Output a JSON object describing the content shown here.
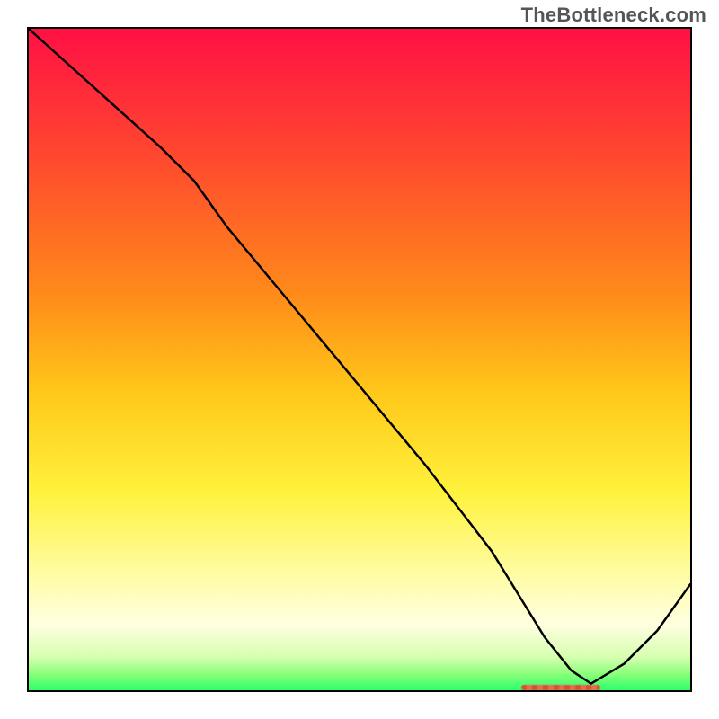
{
  "watermark": "TheBottleneck.com",
  "chart_data": {
    "type": "line",
    "title": "",
    "xlabel": "",
    "ylabel": "",
    "xlim": [
      0,
      100
    ],
    "ylim": [
      0,
      100
    ],
    "x": [
      0,
      10,
      20,
      25,
      30,
      40,
      50,
      60,
      70,
      78,
      82,
      85,
      90,
      95,
      100
    ],
    "y": [
      100,
      91,
      82,
      77,
      70,
      58,
      46,
      34,
      21,
      8,
      3,
      1,
      4,
      9,
      16
    ],
    "gradient_stops": [
      {
        "pos": 0.0,
        "color": "#ff1044"
      },
      {
        "pos": 0.2,
        "color": "#ff4a2e"
      },
      {
        "pos": 0.4,
        "color": "#ff8a1a"
      },
      {
        "pos": 0.55,
        "color": "#ffc81a"
      },
      {
        "pos": 0.7,
        "color": "#fff23c"
      },
      {
        "pos": 0.82,
        "color": "#fffca0"
      },
      {
        "pos": 0.9,
        "color": "#ffffe0"
      },
      {
        "pos": 0.95,
        "color": "#d6ffb0"
      },
      {
        "pos": 0.975,
        "color": "#8cff7a"
      },
      {
        "pos": 1.0,
        "color": "#2cff6c"
      }
    ],
    "marker": {
      "x_start": 74,
      "x_end": 86,
      "y": 1,
      "color": "#e24a33"
    },
    "line_color": "#000000",
    "line_width": 2.5
  }
}
